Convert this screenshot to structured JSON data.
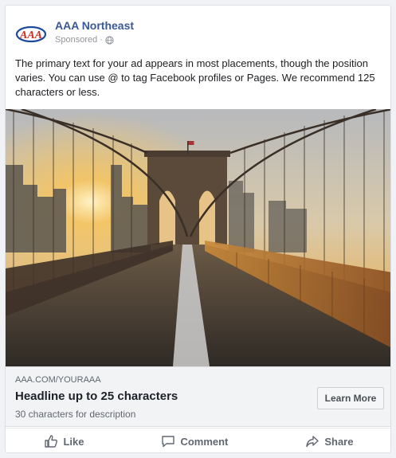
{
  "post": {
    "page_name": "AAA Northeast",
    "sponsored_label": "Sponsored ·",
    "globe_icon": "globe-icon",
    "logo_icon": "aaa-logo",
    "primary_text": "The primary text for your ad appears in most placements, though the position varies. You can use @ to tag Facebook profiles or Pages. We recommend 125 characters or less."
  },
  "link": {
    "domain": "AAA.COM/YOURAAA",
    "headline": "Headline up to 25 characters",
    "description": "30 characters for description",
    "cta_label": "Learn More"
  },
  "actions": {
    "like_label": "Like",
    "comment_label": "Comment",
    "share_label": "Share",
    "like_icon": "thumbs-up-icon",
    "comment_icon": "comment-icon",
    "share_icon": "share-arrow-icon"
  },
  "colors": {
    "page_name": "#385898",
    "secondary_text": "#606770",
    "aaa_red": "#d52b1e",
    "aaa_blue": "#1f4a9c"
  }
}
